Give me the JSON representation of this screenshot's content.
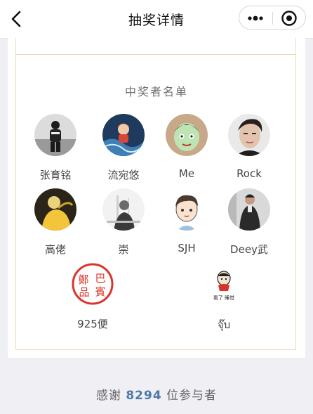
{
  "nav": {
    "title": "抽奖详情"
  },
  "winners_section": {
    "title": "中奖者名单"
  },
  "winners": [
    {
      "name": "张育铭",
      "avatar": "person-standing-avatar"
    },
    {
      "name": "流宛悠",
      "avatar": "cartoon-girl-avatar"
    },
    {
      "name": "Me",
      "avatar": "cartoon-face-avatar"
    },
    {
      "name": "Rock",
      "avatar": "portrait-man-avatar"
    },
    {
      "name": "高佬",
      "avatar": "person-yellow-avatar"
    },
    {
      "name": "崇",
      "avatar": "grayscale-photo-avatar"
    },
    {
      "name": "SJH",
      "avatar": "cartoon-boy-avatar"
    },
    {
      "name": "Deey武",
      "avatar": "man-dark-avatar"
    },
    {
      "name": "925便",
      "avatar": "red-seal-avatar",
      "seal_text": [
        "鄭",
        "巴",
        "賓",
        "品"
      ]
    },
    {
      "name": "จุ๊บ",
      "avatar": "sticker-avatar",
      "sticker_text": "看了 睡觉"
    }
  ],
  "footer": {
    "prefix": "感谢",
    "count": "8294",
    "suffix": "位参与者"
  },
  "colors": {
    "link_blue": "#4f79a8",
    "frame_gold": "#ecd9b8",
    "seal_red": "#d9342b"
  }
}
